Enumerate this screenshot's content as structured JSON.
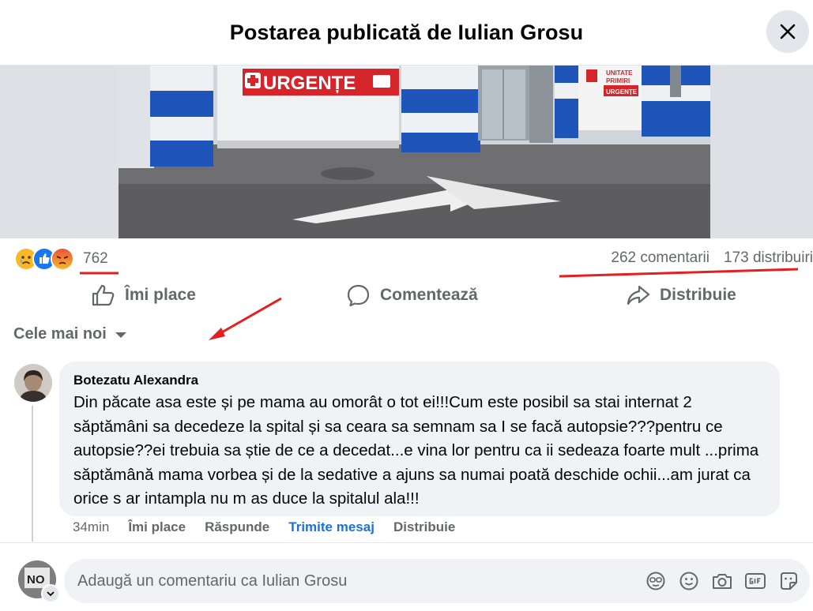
{
  "header": {
    "title": "Postarea publicată de Iulian Grosu"
  },
  "photo": {
    "sign_urgente": "URGENȚE",
    "sign_unit_line1": "UNITATE",
    "sign_unit_line2": "PRIMIRI",
    "sign_unit_line3": "URGENȚE"
  },
  "stats": {
    "reaction_count": "762",
    "comments": "262 comentarii",
    "shares": "173 distribuiri",
    "reaction_icons": [
      "sad-reaction-icon",
      "like-reaction-icon",
      "angry-reaction-icon"
    ]
  },
  "actions": {
    "like": "Îmi place",
    "comment": "Comentează",
    "share": "Distribuie"
  },
  "sort": {
    "label": "Cele mai noi"
  },
  "comment": {
    "author": "Botezatu Alexandra",
    "text": "Din păcate asa este și pe mama au omorât o tot ei!!!Cum este posibil sa stai internat 2 săptămâni sa decedeze la spital și sa ceara sa semnam sa I se facă autopsie???pentru ce autopsie??ei trebuia sa știe de ce a decedat...e vina lor pentru ca ii sedeaza foarte mult ...prima săptămână mama vorbea și de la sedative a ajuns sa numai poată deschide ochii...am jurat ca orice s ar intampla nu m as duce la spitalul ala!!!",
    "time": "34min",
    "like": "Îmi place",
    "reply": "Răspunde",
    "message": "Trimite mesaj",
    "share": "Distribuie"
  },
  "compose": {
    "placeholder": "Adaugă un comentariu ca Iulian Grosu",
    "value": "",
    "avatar_text": "NO"
  },
  "colors": {
    "accent": "#216fdb",
    "annotation": "#e41f1f",
    "muted": "#65676b"
  }
}
